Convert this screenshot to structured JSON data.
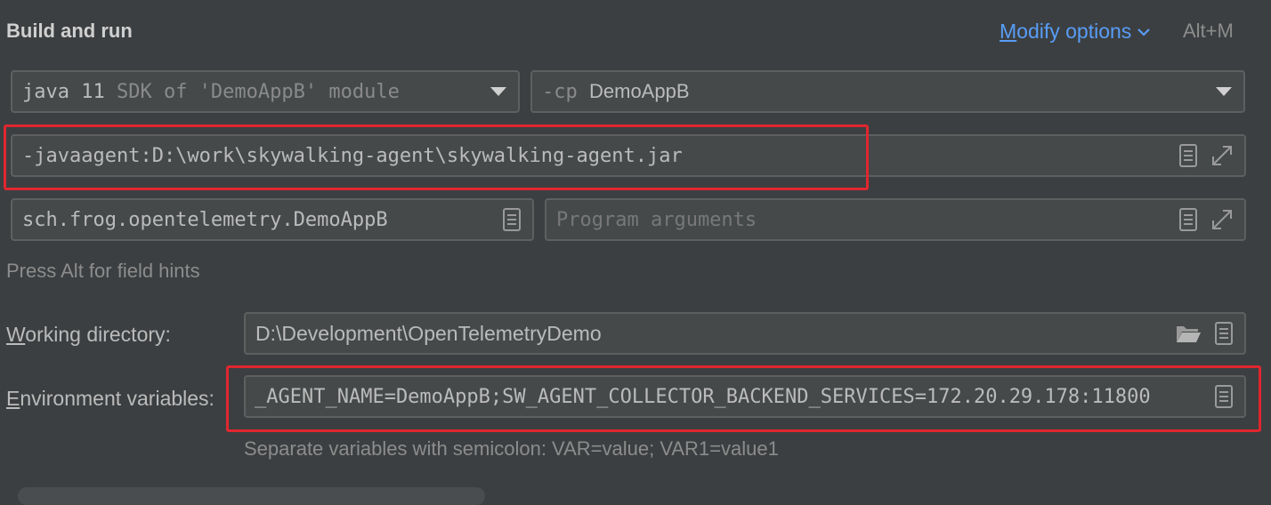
{
  "section": {
    "title": "Build and run",
    "modify_options_first": "M",
    "modify_options_rest": "odify options",
    "shortcut": "Alt+M"
  },
  "jre": {
    "version": "java 11",
    "description": "SDK of 'DemoAppB' module"
  },
  "classpath": {
    "prefix": "-cp",
    "module": "DemoAppB"
  },
  "vm_options": {
    "value": "-javaagent:D:\\work\\skywalking-agent\\skywalking-agent.jar"
  },
  "main_class": {
    "value": "sch.frog.opentelemetry.DemoAppB"
  },
  "program_arguments": {
    "placeholder": "Program arguments"
  },
  "field_hints": "Press Alt for field hints",
  "working_directory": {
    "label_first": "W",
    "label_rest": "orking directory:",
    "value": "D:\\Development\\OpenTelemetryDemo"
  },
  "environment_variables": {
    "label_first": "E",
    "label_rest": "nvironment variables:",
    "value": "_AGENT_NAME=DemoAppB;SW_AGENT_COLLECTOR_BACKEND_SERVICES=172.20.29.178:11800",
    "hint": "Separate variables with semicolon: VAR=value; VAR1=value1"
  },
  "colors": {
    "background": "#3c3f41",
    "field_background": "#45494a",
    "link": "#589df6",
    "highlight_box": "#e0262f"
  }
}
